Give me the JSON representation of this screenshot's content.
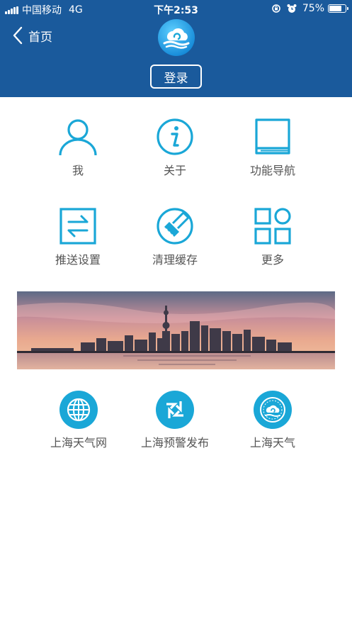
{
  "status_bar": {
    "carrier": "中国移动",
    "network": "4G",
    "time": "下午2:53",
    "battery_text": "75%",
    "battery_level": 0.75
  },
  "header": {
    "back_label": "首页",
    "login_label": "登录",
    "background_color": "#1a5a9c"
  },
  "grid": [
    {
      "label": "我",
      "icon": "person-icon"
    },
    {
      "label": "关于",
      "icon": "info-icon"
    },
    {
      "label": "功能导航",
      "icon": "book-icon"
    },
    {
      "label": "推送设置",
      "icon": "swap-arrows-icon"
    },
    {
      "label": "清理缓存",
      "icon": "broom-icon"
    },
    {
      "label": "更多",
      "icon": "grid-more-icon"
    }
  ],
  "links": [
    {
      "label": "上海天气网",
      "icon": "globe-icon"
    },
    {
      "label": "上海预警发布",
      "icon": "warning-logo-icon"
    },
    {
      "label": "上海天气",
      "icon": "cloud-logo-icon"
    }
  ],
  "colors": {
    "accent": "#1aa7d7",
    "label_text": "#555555"
  }
}
